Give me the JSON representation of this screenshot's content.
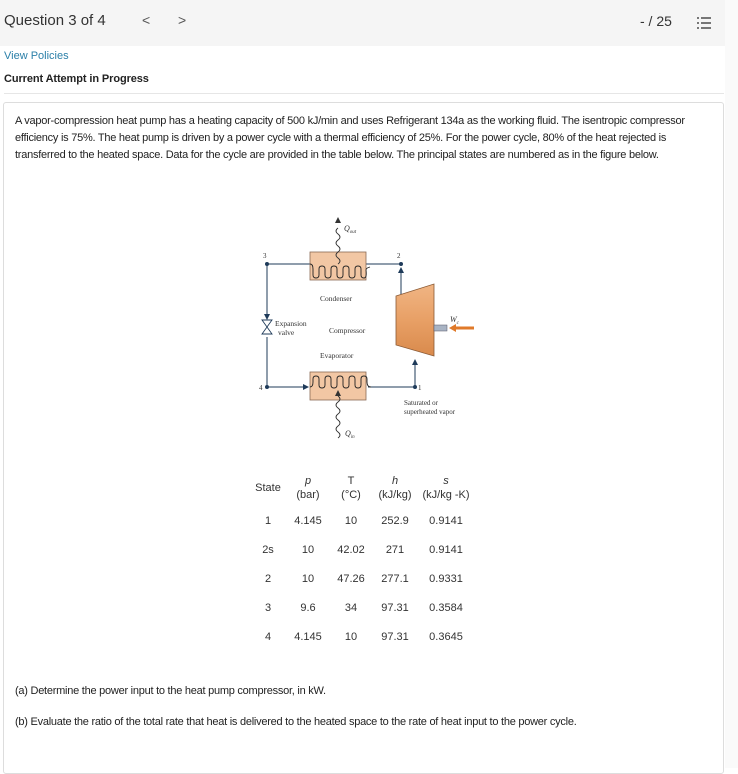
{
  "header": {
    "question_label": "Question 3 of 4",
    "prev_icon": "chevron-left-icon",
    "prev_glyph": "<",
    "next_icon": "chevron-right-icon",
    "next_glyph": ">",
    "score": "- / 25",
    "list_icon": "list-icon"
  },
  "links": {
    "view_policies": "View Policies"
  },
  "status": {
    "attempt": "Current Attempt in Progress"
  },
  "problem": {
    "text": "A vapor-compression heat pump has a heating capacity of 500 kJ/min and uses Refrigerant 134a as the working fluid. The isentropic compressor efficiency is 75%. The heat pump is driven by a power cycle with a thermal efficiency of 25%. For the power cycle, 80% of the heat rejected is transferred to the heated space. Data for the cycle are provided in the table below. The principal states are numbered as in the figure below."
  },
  "figure": {
    "q_out": "Q",
    "q_out_sub": "out",
    "q_in": "Q",
    "q_in_sub": "in",
    "w_c": "W",
    "w_c_sub": "c",
    "condenser": "Condenser",
    "evaporator": "Evaporator",
    "compressor": "Compressor",
    "expansion_1": "Expansion",
    "expansion_2": "valve",
    "state1": "1",
    "state2": "2",
    "state3": "3",
    "state4": "4",
    "vapor_1": "Saturated or",
    "vapor_2": "superheated vapor",
    "colors": {
      "component_fill": "#f2c7a4",
      "compressor_fill": "#e59a5c",
      "work_arrow": "#e07a2a",
      "line": "#1f3b5a"
    }
  },
  "table": {
    "headers": [
      {
        "top": "State",
        "bottom": ""
      },
      {
        "top": "p",
        "bottom": "(bar)"
      },
      {
        "top": "T",
        "bottom": "(°C)"
      },
      {
        "top": "h",
        "bottom": "(kJ/kg)"
      },
      {
        "top": "s",
        "bottom": "(kJ/kg -K)"
      }
    ],
    "rows": [
      [
        "1",
        "4.145",
        "10",
        "252.9",
        "0.9141"
      ],
      [
        "2s",
        "10",
        "42.02",
        "271",
        "0.9141"
      ],
      [
        "2",
        "10",
        "47.26",
        "277.1",
        "0.9331"
      ],
      [
        "3",
        "9.6",
        "34",
        "97.31",
        "0.3584"
      ],
      [
        "4",
        "4.145",
        "10",
        "97.31",
        "0.3645"
      ]
    ]
  },
  "questions": {
    "a": "(a) Determine the power input to the heat pump compressor, in kW.",
    "b": "(b) Evaluate the ratio of the total rate that heat is delivered to the heated space to the rate of heat input to the power cycle."
  }
}
